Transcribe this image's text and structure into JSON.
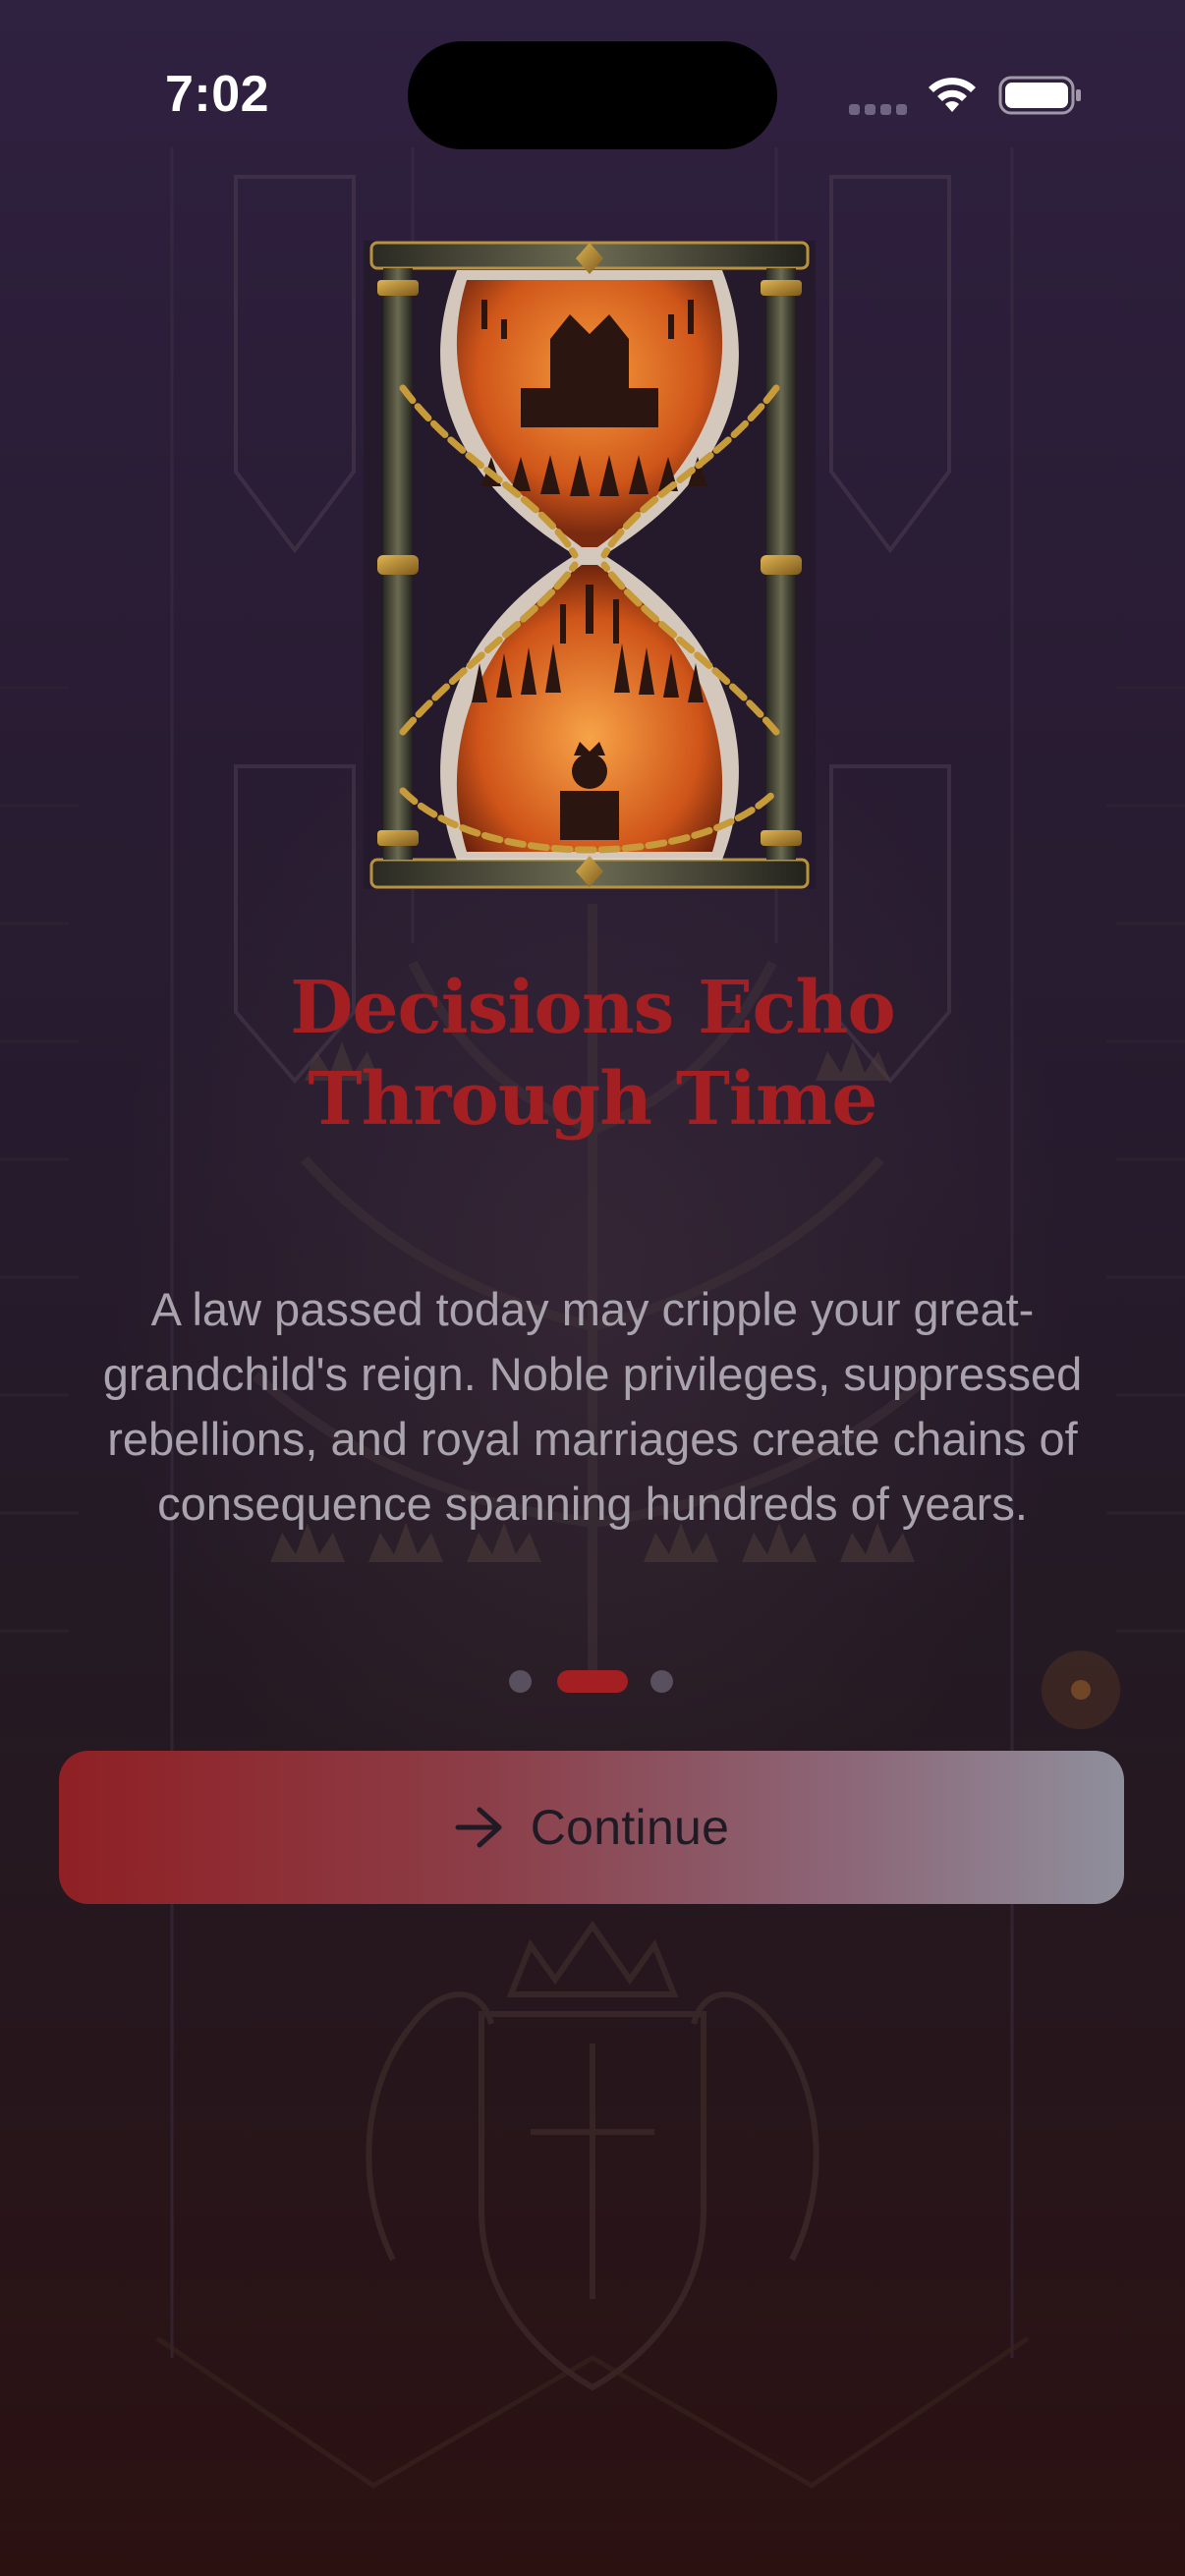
{
  "status_bar": {
    "time": "7:02",
    "icons": [
      "signal-dots-icon",
      "wifi-icon",
      "battery-icon"
    ]
  },
  "onboarding": {
    "hero_image": "hourglass-illustration",
    "title_line_1": "Decisions Echo",
    "title_line_2": "Through Time",
    "body": "A law passed today may cripple your great-grandchild's reign. Noble privileges, suppressed rebellions, and royal marriages create chains of consequence spanning hundreds of years.",
    "page_count": 3,
    "current_page": 2
  },
  "continue_button": {
    "icon": "arrow-right-icon",
    "label": "Continue"
  },
  "colors": {
    "accent_red": "#a31f22",
    "body_text": "#a9a3ad",
    "background_top": "#2f2140",
    "background_bottom": "#2c1111"
  }
}
